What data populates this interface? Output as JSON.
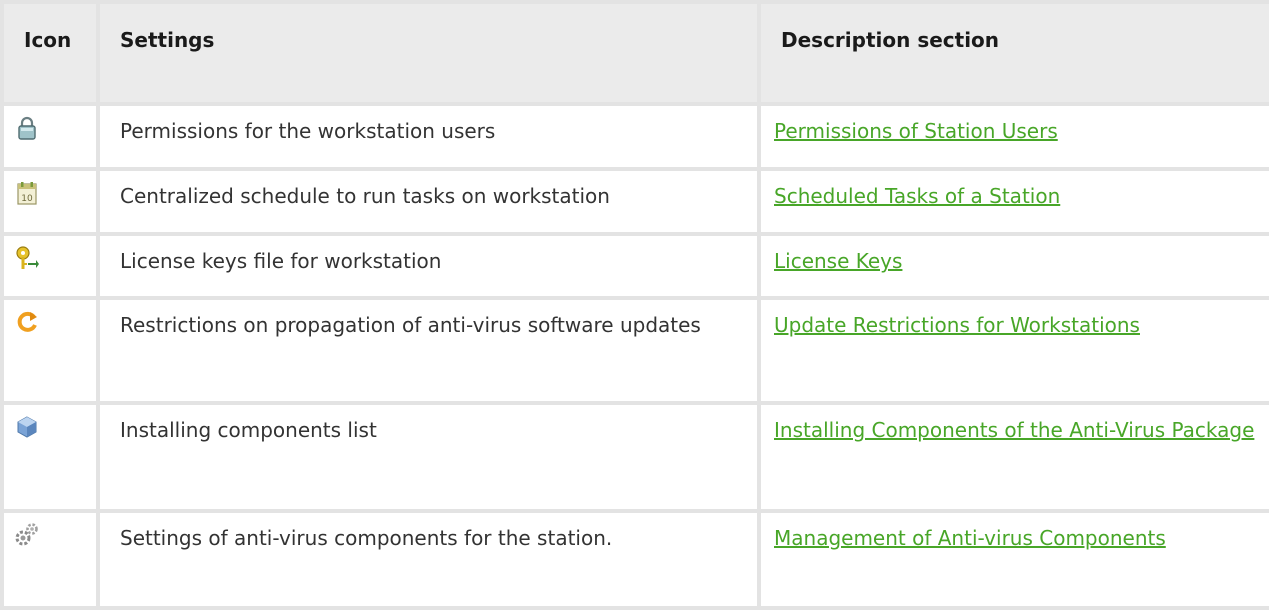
{
  "table": {
    "headers": {
      "icon": "Icon",
      "settings": "Settings",
      "description": "Description section"
    },
    "rows": [
      {
        "icon": "lock-icon",
        "settings": "Permissions for the workstation users",
        "link": "Permissions of Station Users"
      },
      {
        "icon": "calendar-icon",
        "settings": "Centralized schedule to run tasks on workstation",
        "link": "Scheduled Tasks of a Station",
        "icon_text": "10"
      },
      {
        "icon": "key-icon",
        "settings": "License keys file for workstation",
        "link": "License Keys"
      },
      {
        "icon": "refresh-icon",
        "settings": "Restrictions on propagation of anti-virus software updates",
        "link": "Update Restrictions for Workstations"
      },
      {
        "icon": "cube-icon",
        "settings": "Installing components list",
        "link": "Installing Components of the Anti-Virus Package"
      },
      {
        "icon": "gears-icon",
        "settings": "Settings of anti-virus components for the station.",
        "link": "Management of Anti-virus Components"
      }
    ]
  },
  "colors": {
    "link": "#48a628",
    "header_bg": "#ebebeb",
    "border": "#e3e3e3"
  }
}
